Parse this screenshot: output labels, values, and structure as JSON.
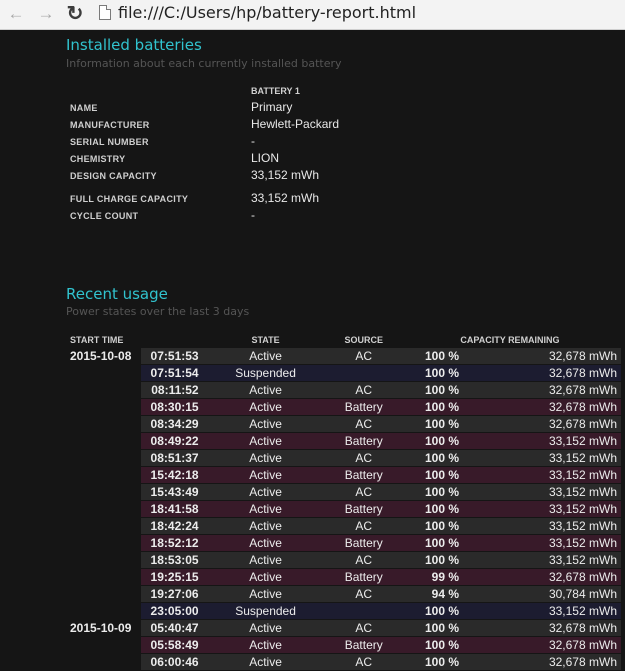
{
  "browser": {
    "url": "file:///C:/Users/hp/battery-report.html",
    "back_icon": "back-arrow-icon",
    "forward_icon": "forward-arrow-icon",
    "reload_icon": "reload-icon",
    "page_icon": "page-icon"
  },
  "installed": {
    "title": "Installed batteries",
    "subtitle": "Information about each currently installed battery",
    "battery_header": "BATTERY 1",
    "rows": [
      {
        "label": "NAME",
        "value": "Primary"
      },
      {
        "label": "MANUFACTURER",
        "value": "Hewlett-Packard"
      },
      {
        "label": "SERIAL NUMBER",
        "value": "-"
      },
      {
        "label": "CHEMISTRY",
        "value": "LION"
      },
      {
        "label": "DESIGN CAPACITY",
        "value": "33,152 mWh"
      },
      {
        "label": "FULL CHARGE CAPACITY",
        "value": "33,152 mWh"
      },
      {
        "label": "CYCLE COUNT",
        "value": "-"
      }
    ]
  },
  "recent": {
    "title": "Recent usage",
    "subtitle": "Power states over the last 3 days",
    "headers": {
      "start_time": "START TIME",
      "state": "STATE",
      "source": "SOURCE",
      "capacity": "CAPACITY REMAINING"
    },
    "rows": [
      {
        "date": "2015-10-08",
        "time": "07:51:53",
        "state": "Active",
        "source": "AC",
        "pct": "100 %",
        "mwh": "32,678 mWh"
      },
      {
        "date": "",
        "time": "07:51:54",
        "state": "Suspended",
        "source": "",
        "pct": "100 %",
        "mwh": "32,678 mWh"
      },
      {
        "date": "",
        "time": "08:11:52",
        "state": "Active",
        "source": "AC",
        "pct": "100 %",
        "mwh": "32,678 mWh"
      },
      {
        "date": "",
        "time": "08:30:15",
        "state": "Active",
        "source": "Battery",
        "pct": "100 %",
        "mwh": "32,678 mWh"
      },
      {
        "date": "",
        "time": "08:34:29",
        "state": "Active",
        "source": "AC",
        "pct": "100 %",
        "mwh": "32,678 mWh"
      },
      {
        "date": "",
        "time": "08:49:22",
        "state": "Active",
        "source": "Battery",
        "pct": "100 %",
        "mwh": "33,152 mWh"
      },
      {
        "date": "",
        "time": "08:51:37",
        "state": "Active",
        "source": "AC",
        "pct": "100 %",
        "mwh": "33,152 mWh"
      },
      {
        "date": "",
        "time": "15:42:18",
        "state": "Active",
        "source": "Battery",
        "pct": "100 %",
        "mwh": "33,152 mWh"
      },
      {
        "date": "",
        "time": "15:43:49",
        "state": "Active",
        "source": "AC",
        "pct": "100 %",
        "mwh": "33,152 mWh"
      },
      {
        "date": "",
        "time": "18:41:58",
        "state": "Active",
        "source": "Battery",
        "pct": "100 %",
        "mwh": "33,152 mWh"
      },
      {
        "date": "",
        "time": "18:42:24",
        "state": "Active",
        "source": "AC",
        "pct": "100 %",
        "mwh": "33,152 mWh"
      },
      {
        "date": "",
        "time": "18:52:12",
        "state": "Active",
        "source": "Battery",
        "pct": "100 %",
        "mwh": "33,152 mWh"
      },
      {
        "date": "",
        "time": "18:53:05",
        "state": "Active",
        "source": "AC",
        "pct": "100 %",
        "mwh": "33,152 mWh"
      },
      {
        "date": "",
        "time": "19:25:15",
        "state": "Active",
        "source": "Battery",
        "pct": "99 %",
        "mwh": "32,678 mWh"
      },
      {
        "date": "",
        "time": "19:27:06",
        "state": "Active",
        "source": "AC",
        "pct": "94 %",
        "mwh": "30,784 mWh"
      },
      {
        "date": "",
        "time": "23:05:00",
        "state": "Suspended",
        "source": "",
        "pct": "100 %",
        "mwh": "33,152 mWh"
      },
      {
        "date": "2015-10-09",
        "time": "05:40:47",
        "state": "Active",
        "source": "AC",
        "pct": "100 %",
        "mwh": "32,678 mWh"
      },
      {
        "date": "",
        "time": "05:58:49",
        "state": "Active",
        "source": "Battery",
        "pct": "100 %",
        "mwh": "32,678 mWh"
      },
      {
        "date": "",
        "time": "06:00:46",
        "state": "Active",
        "source": "AC",
        "pct": "100 %",
        "mwh": "32,678 mWh"
      }
    ]
  },
  "colors": {
    "accent": "#31c3ce",
    "battery_row": "#381a29",
    "suspended_row": "#1c1c30",
    "active_row": "#2a2a2a"
  }
}
